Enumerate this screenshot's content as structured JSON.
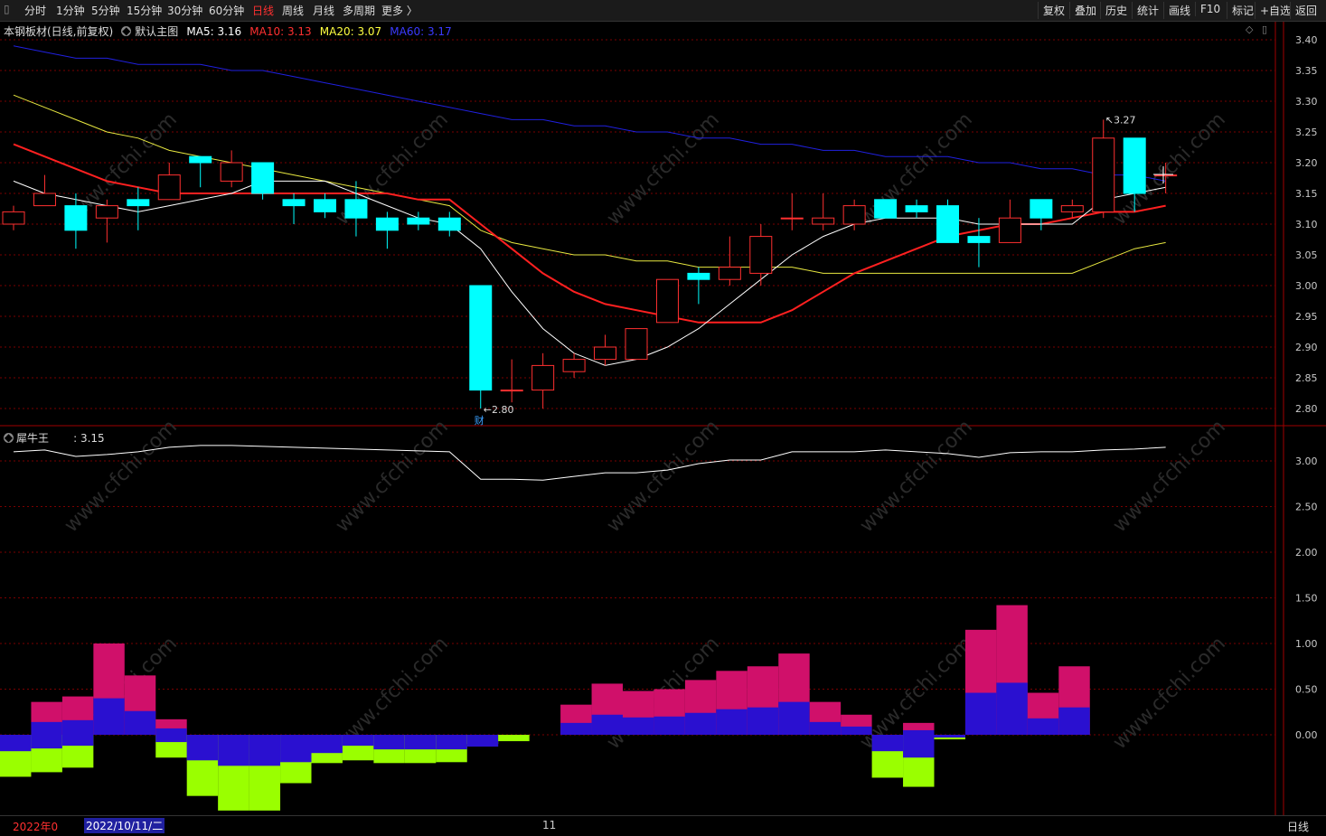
{
  "toolbar": {
    "left_items": [
      "分时",
      "1分钟",
      "5分钟",
      "15分钟",
      "30分钟",
      "60分钟",
      "日线",
      "周线",
      "月线",
      "多周期",
      "更多 〉"
    ],
    "active": "日线",
    "right_items": [
      "复权",
      "叠加",
      "历史",
      "统计",
      "画线",
      "F10",
      "标记",
      "+自选",
      "返回"
    ]
  },
  "main": {
    "stock_title": "本钢板材(日线,前复权)",
    "indicator": "默认主图",
    "ma": [
      {
        "label": "MA5: 3.16",
        "color": "#ffffff"
      },
      {
        "label": "MA10: 3.13",
        "color": "#ff3030"
      },
      {
        "label": "MA20: 3.07",
        "color": "#ffff40"
      },
      {
        "label": "MA60: 3.17",
        "color": "#3a3aff"
      }
    ],
    "low_label": "2.80",
    "high_label": "3.27",
    "event_marker": "财",
    "y_ticks": [
      "3.40",
      "3.35",
      "3.30",
      "3.25",
      "3.20",
      "3.15",
      "3.10",
      "3.05",
      "3.00",
      "2.95",
      "2.90",
      "2.85",
      "2.80"
    ]
  },
  "sub1": {
    "name": "犀牛王",
    "value": ": 3.15",
    "y_ticks": [
      "3.00",
      "2.50",
      "2.00",
      "1.50",
      "1.00",
      "0.50",
      "0.00"
    ]
  },
  "bottom": {
    "date_left": "2022年0",
    "date_cursor": "2022/10/11/二",
    "month_mark": "11",
    "period": "日线"
  },
  "watermark": "www.cfchi.com",
  "colors": {
    "up": "#ff3030",
    "down": "#00ffff",
    "grid": "#7a0000",
    "axis": "#a00000"
  },
  "chart_data": {
    "type": "candlestick",
    "candles": [
      {
        "o": 3.1,
        "c": 3.12,
        "h": 3.13,
        "l": 3.09
      },
      {
        "o": 3.13,
        "c": 3.15,
        "h": 3.18,
        "l": 3.13
      },
      {
        "o": 3.13,
        "c": 3.09,
        "h": 3.15,
        "l": 3.06
      },
      {
        "o": 3.11,
        "c": 3.13,
        "h": 3.14,
        "l": 3.07
      },
      {
        "o": 3.14,
        "c": 3.13,
        "h": 3.16,
        "l": 3.09
      },
      {
        "o": 3.14,
        "c": 3.18,
        "h": 3.2,
        "l": 3.14
      },
      {
        "o": 3.21,
        "c": 3.2,
        "h": 3.21,
        "l": 3.16
      },
      {
        "o": 3.17,
        "c": 3.2,
        "h": 3.22,
        "l": 3.16
      },
      {
        "o": 3.2,
        "c": 3.15,
        "h": 3.2,
        "l": 3.14
      },
      {
        "o": 3.14,
        "c": 3.13,
        "h": 3.15,
        "l": 3.1
      },
      {
        "o": 3.14,
        "c": 3.12,
        "h": 3.15,
        "l": 3.11
      },
      {
        "o": 3.14,
        "c": 3.11,
        "h": 3.17,
        "l": 3.08
      },
      {
        "o": 3.11,
        "c": 3.09,
        "h": 3.12,
        "l": 3.06
      },
      {
        "o": 3.11,
        "c": 3.1,
        "h": 3.12,
        "l": 3.09
      },
      {
        "o": 3.11,
        "c": 3.09,
        "h": 3.12,
        "l": 3.08
      },
      {
        "o": 3.0,
        "c": 2.83,
        "h": 3.0,
        "l": 2.8
      },
      {
        "o": 2.83,
        "c": 2.83,
        "h": 2.88,
        "l": 2.81
      },
      {
        "o": 2.83,
        "c": 2.87,
        "h": 2.89,
        "l": 2.8
      },
      {
        "o": 2.86,
        "c": 2.88,
        "h": 2.89,
        "l": 2.85
      },
      {
        "o": 2.88,
        "c": 2.9,
        "h": 2.92,
        "l": 2.87
      },
      {
        "o": 2.88,
        "c": 2.93,
        "h": 2.93,
        "l": 2.88
      },
      {
        "o": 2.94,
        "c": 3.01,
        "h": 3.01,
        "l": 2.94
      },
      {
        "o": 3.02,
        "c": 3.01,
        "h": 3.03,
        "l": 2.97
      },
      {
        "o": 3.01,
        "c": 3.03,
        "h": 3.08,
        "l": 3.0
      },
      {
        "o": 3.02,
        "c": 3.08,
        "h": 3.1,
        "l": 3.0
      },
      {
        "o": 3.11,
        "c": 3.11,
        "h": 3.15,
        "l": 3.09
      },
      {
        "o": 3.1,
        "c": 3.11,
        "h": 3.15,
        "l": 3.09
      },
      {
        "o": 3.1,
        "c": 3.13,
        "h": 3.14,
        "l": 3.09
      },
      {
        "o": 3.14,
        "c": 3.11,
        "h": 3.14,
        "l": 3.11
      },
      {
        "o": 3.13,
        "c": 3.12,
        "h": 3.14,
        "l": 3.11
      },
      {
        "o": 3.13,
        "c": 3.07,
        "h": 3.14,
        "l": 3.07
      },
      {
        "o": 3.08,
        "c": 3.07,
        "h": 3.11,
        "l": 3.03
      },
      {
        "o": 3.07,
        "c": 3.11,
        "h": 3.14,
        "l": 3.07
      },
      {
        "o": 3.14,
        "c": 3.11,
        "h": 3.14,
        "l": 3.09
      },
      {
        "o": 3.12,
        "c": 3.13,
        "h": 3.14,
        "l": 3.11
      },
      {
        "o": 3.12,
        "c": 3.24,
        "h": 3.27,
        "l": 3.11
      },
      {
        "o": 3.24,
        "c": 3.15,
        "h": 3.24,
        "l": 3.12
      },
      {
        "o": 3.18,
        "c": 3.18,
        "h": 3.2,
        "l": 3.15
      }
    ],
    "ma5": [
      3.17,
      3.15,
      3.14,
      3.13,
      3.12,
      3.13,
      3.14,
      3.15,
      3.17,
      3.17,
      3.17,
      3.15,
      3.13,
      3.11,
      3.1,
      3.06,
      2.99,
      2.93,
      2.89,
      2.87,
      2.88,
      2.9,
      2.93,
      2.97,
      3.01,
      3.05,
      3.08,
      3.1,
      3.11,
      3.11,
      3.11,
      3.1,
      3.1,
      3.1,
      3.1,
      3.14,
      3.15,
      3.16
    ],
    "ma10": [
      3.23,
      3.21,
      3.19,
      3.17,
      3.16,
      3.15,
      3.15,
      3.15,
      3.15,
      3.15,
      3.15,
      3.15,
      3.15,
      3.14,
      3.14,
      3.1,
      3.06,
      3.02,
      2.99,
      2.97,
      2.96,
      2.95,
      2.94,
      2.94,
      2.94,
      2.96,
      2.99,
      3.02,
      3.04,
      3.06,
      3.08,
      3.09,
      3.1,
      3.1,
      3.11,
      3.12,
      3.12,
      3.13
    ],
    "ma20": [
      3.31,
      3.29,
      3.27,
      3.25,
      3.24,
      3.22,
      3.21,
      3.2,
      3.19,
      3.18,
      3.17,
      3.16,
      3.15,
      3.14,
      3.13,
      3.09,
      3.07,
      3.06,
      3.05,
      3.05,
      3.04,
      3.04,
      3.03,
      3.03,
      3.03,
      3.03,
      3.02,
      3.02,
      3.02,
      3.02,
      3.02,
      3.02,
      3.02,
      3.02,
      3.02,
      3.04,
      3.06,
      3.07
    ],
    "ma60": [
      3.39,
      3.38,
      3.37,
      3.37,
      3.36,
      3.36,
      3.36,
      3.35,
      3.35,
      3.34,
      3.33,
      3.32,
      3.31,
      3.3,
      3.29,
      3.28,
      3.27,
      3.27,
      3.26,
      3.26,
      3.25,
      3.25,
      3.24,
      3.24,
      3.23,
      3.23,
      3.22,
      3.22,
      3.21,
      3.21,
      3.21,
      3.2,
      3.2,
      3.19,
      3.19,
      3.18,
      3.18,
      3.17
    ],
    "sub_line": [
      3.1,
      3.12,
      3.05,
      3.07,
      3.1,
      3.15,
      3.17,
      3.17,
      3.16,
      3.15,
      3.14,
      3.13,
      3.12,
      3.11,
      3.1,
      2.8,
      2.8,
      2.79,
      2.83,
      2.87,
      2.87,
      2.9,
      2.97,
      3.01,
      3.01,
      3.1,
      3.1,
      3.1,
      3.12,
      3.1,
      3.08,
      3.04,
      3.09,
      3.1,
      3.1,
      3.12,
      3.13,
      3.15
    ],
    "hist_top": [
      0,
      0.36,
      0.42,
      1.0,
      0.65,
      0.17,
      0,
      0,
      0,
      0,
      0,
      0,
      0,
      0,
      0,
      0,
      0,
      0,
      0.33,
      0.56,
      0.48,
      0.5,
      0.6,
      0.7,
      0.75,
      0.89,
      0.36,
      0.22,
      0,
      0.13,
      0,
      1.15,
      1.42,
      0.46,
      0.75
    ],
    "hist_mid": [
      0,
      0.14,
      0.16,
      0.4,
      0.26,
      0.07,
      0,
      0,
      0,
      0,
      0,
      0,
      0,
      0,
      0,
      0,
      0,
      0,
      0.13,
      0.22,
      0.19,
      0.2,
      0.24,
      0.28,
      0.3,
      0.36,
      0.14,
      0.09,
      0,
      0.05,
      0,
      0.46,
      0.57,
      0.18,
      0.3
    ],
    "hist_neg_blue": [
      -0.18,
      -0.15,
      -0.12,
      0,
      0,
      -0.08,
      -0.28,
      -0.34,
      -0.34,
      -0.3,
      -0.2,
      -0.12,
      -0.16,
      -0.16,
      -0.16,
      -0.13,
      0,
      0,
      0,
      0,
      0,
      0,
      0,
      0,
      0,
      0,
      0,
      0,
      -0.18,
      -0.25,
      -0.03,
      0,
      0,
      0,
      0
    ],
    "hist_neg_green": [
      -0.46,
      -0.41,
      -0.36,
      0,
      0,
      -0.25,
      -0.67,
      -0.83,
      -0.83,
      -0.53,
      -0.31,
      -0.28,
      -0.31,
      -0.31,
      -0.3,
      -0.1,
      -0.07,
      0,
      0,
      0,
      0,
      0,
      0,
      0,
      0,
      0,
      0,
      0,
      -0.47,
      -0.57,
      -0.05,
      0,
      0,
      0,
      0
    ]
  }
}
